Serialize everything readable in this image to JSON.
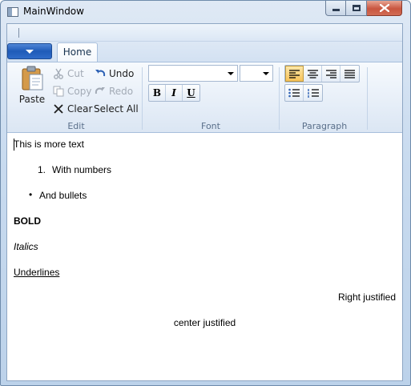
{
  "window": {
    "title": "MainWindow"
  },
  "caption": {
    "minimize_icon": "minimize-icon",
    "maximize_icon": "maximize-icon",
    "close_icon": "close-icon"
  },
  "ribbon": {
    "app_menu_icon": "dropdown-arrow-icon",
    "tabs": [
      {
        "label": "Home",
        "selected": true
      }
    ],
    "groups": {
      "edit": {
        "label": "Edit",
        "paste": {
          "label": "Paste",
          "icon": "clipboard-icon"
        },
        "cut": {
          "label": "Cut",
          "icon": "scissors-icon",
          "enabled": false
        },
        "copy": {
          "label": "Copy",
          "icon": "copy-icon",
          "enabled": false
        },
        "clear": {
          "label": "Clear",
          "icon": "x-icon",
          "enabled": true
        },
        "undo": {
          "label": "Undo",
          "icon": "undo-icon",
          "enabled": true
        },
        "redo": {
          "label": "Redo",
          "icon": "redo-icon",
          "enabled": false
        },
        "select_all": {
          "label": "Select All",
          "enabled": true
        }
      },
      "font": {
        "label": "Font",
        "font_family_value": "",
        "font_size_value": "",
        "bold_label": "B",
        "italic_label": "I",
        "underline_label": "U"
      },
      "paragraph": {
        "label": "Paragraph",
        "alignment_selected": "left",
        "alignments": [
          "left",
          "center",
          "right",
          "justify"
        ],
        "lists": [
          "bullets",
          "numbering"
        ]
      }
    }
  },
  "document": {
    "line1": "This is more text",
    "numbered_item_marker": "1.",
    "numbered_item": "With numbers",
    "bullet_marker": "•",
    "bullet_item": "And bullets",
    "bold": "BOLD",
    "italic": "Italics",
    "underline": "Underlines",
    "right": "Right justified",
    "center": "center justified"
  },
  "colors": {
    "accent": "#1f5bb8",
    "active_alignment": "#f7c35a",
    "close_button": "#c8553f"
  }
}
